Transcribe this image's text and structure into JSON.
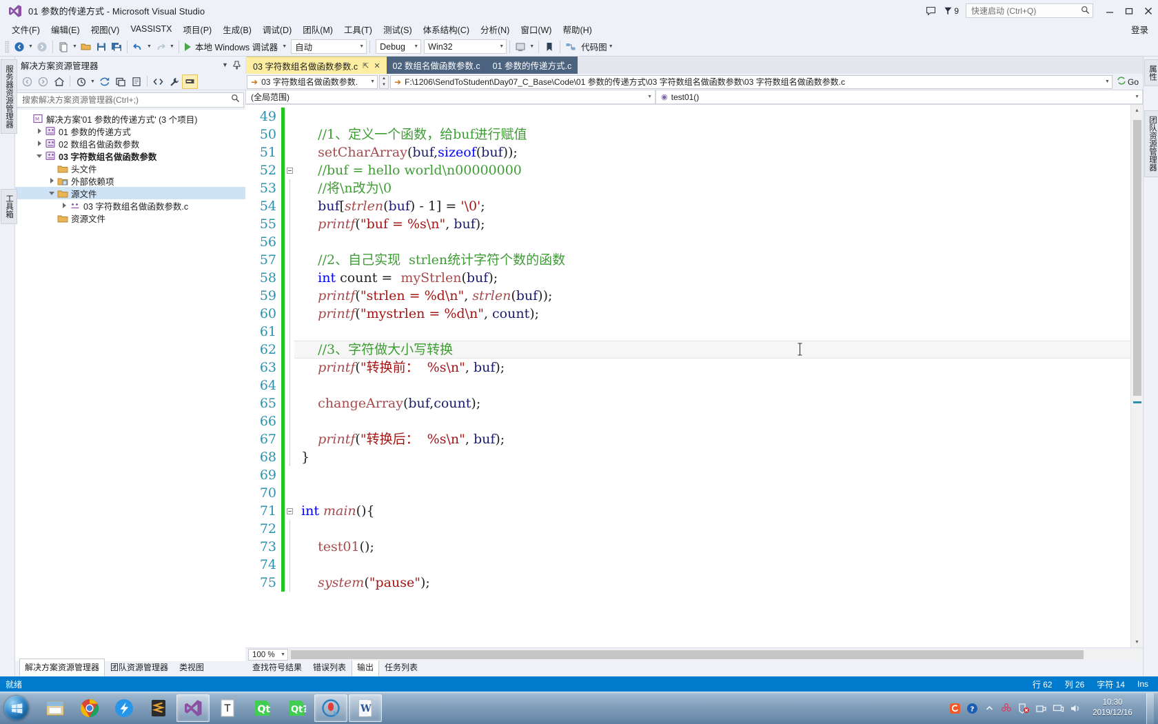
{
  "window": {
    "title": "01 参数的传递方式 - Microsoft Visual Studio",
    "minimize_label": "最小化",
    "maximize_label": "最大化",
    "close_label": "关闭"
  },
  "titlebar": {
    "feedback_icon": "feedback-balloon-icon",
    "notification_icon": "notification-flag-icon",
    "notification_count": "9",
    "quick_launch_placeholder": "快速启动 (Ctrl+Q)",
    "quick_launch_value": "",
    "search_icon": "search-icon"
  },
  "menu": {
    "items": [
      "文件(F)",
      "编辑(E)",
      "视图(V)",
      "VASSISTX",
      "项目(P)",
      "生成(B)",
      "调试(D)",
      "团队(M)",
      "工具(T)",
      "测试(S)",
      "体系结构(C)",
      "分析(N)",
      "窗口(W)",
      "帮助(H)"
    ],
    "signin": "登录"
  },
  "toolbar": {
    "nav_back_icon": "navigate-back-icon",
    "nav_forward_icon": "navigate-forward-icon",
    "new_project_icon": "new-project-icon",
    "open_file_icon": "open-file-icon",
    "save_icon": "save-icon",
    "save_all_icon": "save-all-icon",
    "undo_icon": "undo-icon",
    "redo_icon": "redo-icon",
    "start_label": "本地 Windows 调试器",
    "start_icon": "play-triangle-icon",
    "auto_combo": "自动",
    "config_combo": "Debug",
    "platform_combo": "Win32",
    "attach_icon": "attach-process-icon",
    "code_map_label": "代码图",
    "code_map_icon": "code-map-icon",
    "bookmark_icon": "bookmark-icon"
  },
  "rails": {
    "left": [
      "服务器资源管理器",
      "工具箱"
    ],
    "right": [
      "属性",
      "团队资源管理器"
    ]
  },
  "solution_explorer": {
    "title": "解决方案资源管理器",
    "dropdown_icon": "chevron-down-icon",
    "pin_icon": "pin-icon",
    "toolbar_icons": [
      "back-icon",
      "forward-icon",
      "home-icon",
      "pending-changes-icon",
      "refresh-icon",
      "collapse-all-icon",
      "show-all-files-icon",
      "view-code-icon",
      "properties-icon",
      "preview-selected-icon"
    ],
    "search_placeholder": "搜索解决方案资源管理器(Ctrl+;)",
    "search_value": "",
    "tree": [
      {
        "label": "解决方案'01 参数的传递方式' (3 个项目)",
        "indent": 0,
        "twisty": "none",
        "icon": "solution-icon",
        "bold": false,
        "selected": false
      },
      {
        "label": "01 参数的传递方式",
        "indent": 1,
        "twisty": "collapsed",
        "icon": "cpp-project-icon",
        "bold": false,
        "selected": false
      },
      {
        "label": "02 数组名做函数参数",
        "indent": 1,
        "twisty": "collapsed",
        "icon": "cpp-project-icon",
        "bold": false,
        "selected": false
      },
      {
        "label": "03 字符数组名做函数参数",
        "indent": 1,
        "twisty": "expanded",
        "icon": "cpp-project-icon",
        "bold": true,
        "selected": false
      },
      {
        "label": "头文件",
        "indent": 2,
        "twisty": "none",
        "icon": "folder-icon",
        "bold": false,
        "selected": false
      },
      {
        "label": "外部依赖项",
        "indent": 2,
        "twisty": "collapsed",
        "icon": "folder-ext-icon",
        "bold": false,
        "selected": false
      },
      {
        "label": "源文件",
        "indent": 2,
        "twisty": "expanded",
        "icon": "folder-icon",
        "bold": false,
        "selected": true
      },
      {
        "label": "03 字符数组名做函数参数.c",
        "indent": 3,
        "twisty": "collapsed",
        "icon": "c-file-icon",
        "bold": false,
        "selected": false
      },
      {
        "label": "资源文件",
        "indent": 2,
        "twisty": "none",
        "icon": "folder-icon",
        "bold": false,
        "selected": false
      }
    ],
    "bottom_tabs": [
      {
        "label": "解决方案资源管理器",
        "active": true
      },
      {
        "label": "团队资源管理器",
        "active": false
      },
      {
        "label": "类视图",
        "active": false
      }
    ]
  },
  "editor": {
    "tabs": [
      {
        "label": "03 字符数组名做函数参数.c",
        "active": true,
        "pin_icon": "pin-icon",
        "close_icon": "close-icon"
      },
      {
        "label": "02 数组名做函数参数.c",
        "active": false
      },
      {
        "label": "01 参数的传递方式.c",
        "active": false
      }
    ],
    "nav_file": "03 字符数组名做函数参数.",
    "nav_path": "F:\\1206\\SendToStudent\\Day07_C_Base\\Code\\01 参数的传递方式\\03 字符数组名做函数参数\\03 字符数组名做函数参数.c",
    "go_label": "Go",
    "scope_left": "(全局范围)",
    "scope_right": "test01()",
    "zoom_level": "100 %",
    "first_line": 49,
    "lines": [
      {
        "n": 49,
        "tokens": []
      },
      {
        "n": 50,
        "tokens": [
          {
            "t": "    ",
            "c": "pl"
          },
          {
            "t": "//1、定义一个函数，给buf进行赋值",
            "c": "cm"
          }
        ]
      },
      {
        "n": 51,
        "tokens": [
          {
            "t": "    ",
            "c": "pl"
          },
          {
            "t": "setCharArray",
            "c": "fnp"
          },
          {
            "t": "(",
            "c": "pl"
          },
          {
            "t": "buf",
            "c": "idf"
          },
          {
            "t": ",",
            "c": "pl"
          },
          {
            "t": "sizeof",
            "c": "k"
          },
          {
            "t": "(",
            "c": "pl"
          },
          {
            "t": "buf",
            "c": "idf"
          },
          {
            "t": "));",
            "c": "pl"
          }
        ]
      },
      {
        "n": 52,
        "tokens": [
          {
            "t": "    ",
            "c": "pl"
          },
          {
            "t": "//buf = hello world\\n00000000",
            "c": "cm"
          }
        ],
        "fold": true
      },
      {
        "n": 53,
        "tokens": [
          {
            "t": "    ",
            "c": "pl"
          },
          {
            "t": "//将\\n改为\\0",
            "c": "cm"
          }
        ]
      },
      {
        "n": 54,
        "tokens": [
          {
            "t": "    ",
            "c": "pl"
          },
          {
            "t": "buf",
            "c": "idf"
          },
          {
            "t": "[",
            "c": "pl"
          },
          {
            "t": "strlen",
            "c": "fn"
          },
          {
            "t": "(",
            "c": "pl"
          },
          {
            "t": "buf",
            "c": "idf"
          },
          {
            "t": ") - 1] = ",
            "c": "pl"
          },
          {
            "t": "'\\0'",
            "c": "st"
          },
          {
            "t": ";",
            "c": "pl"
          }
        ]
      },
      {
        "n": 55,
        "tokens": [
          {
            "t": "    ",
            "c": "pl"
          },
          {
            "t": "printf",
            "c": "fn"
          },
          {
            "t": "(",
            "c": "pl"
          },
          {
            "t": "\"buf = %s\\n\"",
            "c": "st"
          },
          {
            "t": ", ",
            "c": "pl"
          },
          {
            "t": "buf",
            "c": "idf"
          },
          {
            "t": ");",
            "c": "pl"
          }
        ]
      },
      {
        "n": 56,
        "tokens": []
      },
      {
        "n": 57,
        "tokens": [
          {
            "t": "    ",
            "c": "pl"
          },
          {
            "t": "//2、自己实现  strlen统计字符个数的函数",
            "c": "cm"
          }
        ]
      },
      {
        "n": 58,
        "tokens": [
          {
            "t": "    ",
            "c": "pl"
          },
          {
            "t": "int",
            "c": "k"
          },
          {
            "t": " count =  ",
            "c": "pl"
          },
          {
            "t": "myStrlen",
            "c": "fnp"
          },
          {
            "t": "(",
            "c": "pl"
          },
          {
            "t": "buf",
            "c": "idf"
          },
          {
            "t": ");",
            "c": "pl"
          }
        ]
      },
      {
        "n": 59,
        "tokens": [
          {
            "t": "    ",
            "c": "pl"
          },
          {
            "t": "printf",
            "c": "fn"
          },
          {
            "t": "(",
            "c": "pl"
          },
          {
            "t": "\"strlen = %d\\n\"",
            "c": "st"
          },
          {
            "t": ", ",
            "c": "pl"
          },
          {
            "t": "strlen",
            "c": "fn"
          },
          {
            "t": "(",
            "c": "pl"
          },
          {
            "t": "buf",
            "c": "idf"
          },
          {
            "t": "));",
            "c": "pl"
          }
        ]
      },
      {
        "n": 60,
        "tokens": [
          {
            "t": "    ",
            "c": "pl"
          },
          {
            "t": "printf",
            "c": "fn"
          },
          {
            "t": "(",
            "c": "pl"
          },
          {
            "t": "\"mystrlen = %d\\n\"",
            "c": "st"
          },
          {
            "t": ", ",
            "c": "pl"
          },
          {
            "t": "count",
            "c": "idf"
          },
          {
            "t": ");",
            "c": "pl"
          }
        ]
      },
      {
        "n": 61,
        "tokens": []
      },
      {
        "n": 62,
        "tokens": [
          {
            "t": "    ",
            "c": "pl"
          },
          {
            "t": "//3、字符做大小写转换",
            "c": "cm"
          }
        ],
        "current": true
      },
      {
        "n": 63,
        "tokens": [
          {
            "t": "    ",
            "c": "pl"
          },
          {
            "t": "printf",
            "c": "fn"
          },
          {
            "t": "(",
            "c": "pl"
          },
          {
            "t": "\"转换前：  %s\\n\"",
            "c": "st"
          },
          {
            "t": ", ",
            "c": "pl"
          },
          {
            "t": "buf",
            "c": "idf"
          },
          {
            "t": ");",
            "c": "pl"
          }
        ]
      },
      {
        "n": 64,
        "tokens": []
      },
      {
        "n": 65,
        "tokens": [
          {
            "t": "    ",
            "c": "pl"
          },
          {
            "t": "changeArray",
            "c": "fnp"
          },
          {
            "t": "(",
            "c": "pl"
          },
          {
            "t": "buf",
            "c": "idf"
          },
          {
            "t": ",",
            "c": "pl"
          },
          {
            "t": "count",
            "c": "idf"
          },
          {
            "t": ");",
            "c": "pl"
          }
        ]
      },
      {
        "n": 66,
        "tokens": []
      },
      {
        "n": 67,
        "tokens": [
          {
            "t": "    ",
            "c": "pl"
          },
          {
            "t": "printf",
            "c": "fn"
          },
          {
            "t": "(",
            "c": "pl"
          },
          {
            "t": "\"转换后：  %s\\n\"",
            "c": "st"
          },
          {
            "t": ", ",
            "c": "pl"
          },
          {
            "t": "buf",
            "c": "idf"
          },
          {
            "t": ");",
            "c": "pl"
          }
        ]
      },
      {
        "n": 68,
        "tokens": [
          {
            "t": "}",
            "c": "pl"
          }
        ]
      },
      {
        "n": 69,
        "tokens": []
      },
      {
        "n": 70,
        "tokens": []
      },
      {
        "n": 71,
        "tokens": [
          {
            "t": "int",
            "c": "k"
          },
          {
            "t": " ",
            "c": "pl"
          },
          {
            "t": "main",
            "c": "fn"
          },
          {
            "t": "(){",
            "c": "pl"
          }
        ],
        "fold": true
      },
      {
        "n": 72,
        "tokens": []
      },
      {
        "n": 73,
        "tokens": [
          {
            "t": "    ",
            "c": "pl"
          },
          {
            "t": "test01",
            "c": "fnp"
          },
          {
            "t": "();",
            "c": "pl"
          }
        ]
      },
      {
        "n": 74,
        "tokens": []
      },
      {
        "n": 75,
        "tokens": [
          {
            "t": "    ",
            "c": "pl"
          },
          {
            "t": "system",
            "c": "fn"
          },
          {
            "t": "(",
            "c": "pl"
          },
          {
            "t": "\"pause\"",
            "c": "st"
          },
          {
            "t": ");",
            "c": "pl"
          }
        ]
      }
    ]
  },
  "output_tabs": [
    {
      "label": "查找符号结果",
      "active": false
    },
    {
      "label": "错误列表",
      "active": false
    },
    {
      "label": "输出",
      "active": true
    },
    {
      "label": "任务列表",
      "active": false
    }
  ],
  "statusbar": {
    "state": "就绪",
    "line": "行 62",
    "col": "列 26",
    "char": "字符 14",
    "insert_mode": "Ins"
  },
  "taskbar": {
    "start_icon": "windows-start-orb-icon",
    "items": [
      {
        "icon": "file-explorer-icon",
        "running": false
      },
      {
        "icon": "google-chrome-icon",
        "running": false
      },
      {
        "icon": "thunder-download-icon",
        "running": false
      },
      {
        "icon": "sublime-text-icon",
        "running": false
      },
      {
        "icon": "visual-studio-icon",
        "running": true
      },
      {
        "icon": "typora-icon",
        "running": false
      },
      {
        "icon": "qt-creator-icon",
        "running": false
      },
      {
        "icon": "qt-assistant-icon",
        "running": false
      },
      {
        "icon": "screen-recorder-icon",
        "running": true
      },
      {
        "icon": "word-icon",
        "running": true
      }
    ],
    "tray": [
      "sogou-input-icon",
      "help-icon",
      "show-hidden-icons-icon",
      "flower-icon",
      "security-alert-icon",
      "usb-eject-icon",
      "network-icon",
      "volume-icon"
    ],
    "time": "10:30",
    "date": "2019/12/16"
  }
}
